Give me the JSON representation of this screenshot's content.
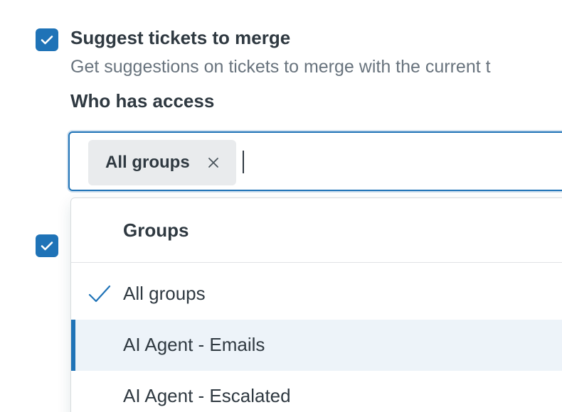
{
  "settings": {
    "suggest_merge": {
      "checked": true,
      "title": "Suggest tickets to merge",
      "description": "Get suggestions on tickets to merge with the current t"
    },
    "second_option": {
      "checked": true
    }
  },
  "access": {
    "label": "Who has access",
    "selected_tag": "All groups",
    "input_value": ""
  },
  "menu": {
    "header": "Groups",
    "items": [
      {
        "label": "All groups",
        "selected": true
      },
      {
        "label": "AI Agent - Emails",
        "focused": true
      },
      {
        "label": "AI Agent - Escalated"
      }
    ]
  },
  "colors": {
    "accent": "#1f73b7",
    "focused_row": "#edf3f9",
    "tag_bg": "#e9ebed"
  }
}
